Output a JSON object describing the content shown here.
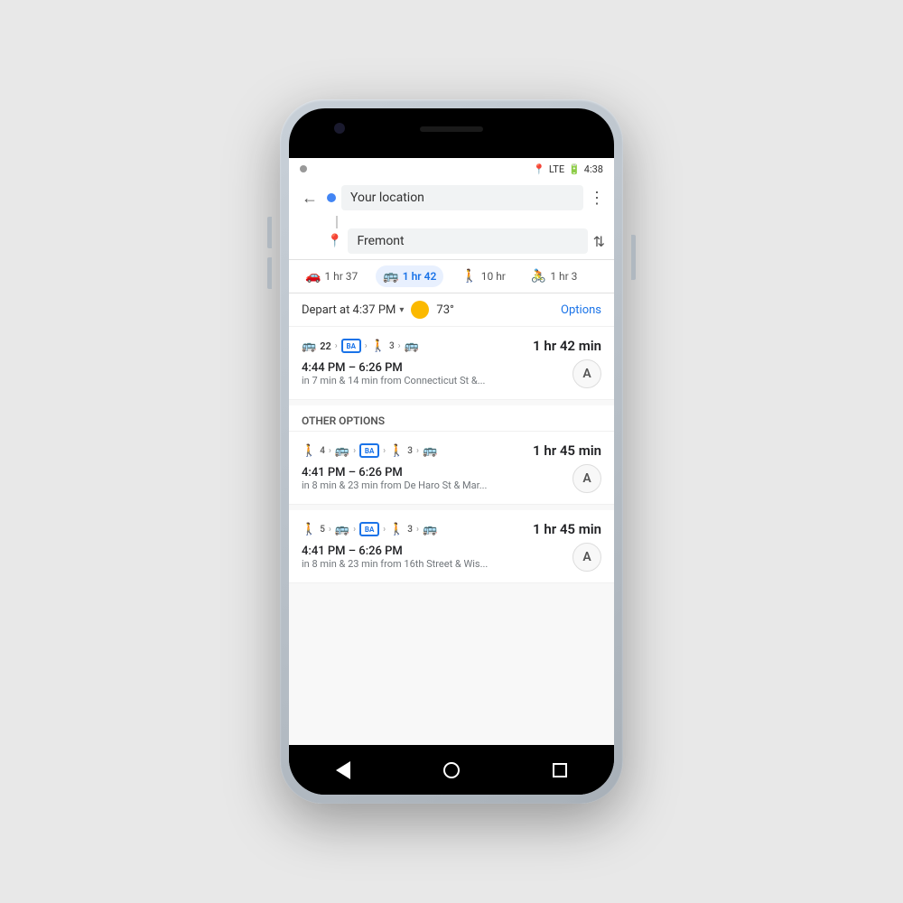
{
  "status": {
    "time": "4:38",
    "lte": "LTE",
    "battery": "⚡"
  },
  "header": {
    "back_icon": "←",
    "origin_label": "Your location",
    "destination_label": "Fremont",
    "more_icon": "⋮",
    "swap_icon": "⇅"
  },
  "tabs": [
    {
      "icon": "🚗",
      "label": "1 hr 37",
      "active": false
    },
    {
      "icon": "🚌",
      "label": "1 hr 42",
      "active": true
    },
    {
      "icon": "🚶",
      "label": "10 hr",
      "active": false
    },
    {
      "icon": "🚲",
      "label": "1 hr 3",
      "active": false
    }
  ],
  "depart": {
    "text": "Depart at 4:37 PM",
    "temp": "73°",
    "options_label": "Options"
  },
  "routes": [
    {
      "icons_text": "22  ›  BART  ›  🚶3  ›  🚌",
      "duration": "1 hr 42 min",
      "time_main": "4:44 PM – 6:26 PM",
      "time_sub": "in 7 min & 14 min from Connecticut St &...",
      "avatar": "A"
    }
  ],
  "other_options_label": "OTHER OPTIONS",
  "other_routes": [
    {
      "icons_text": "🚶4  ›  🚌  ›  BART  ›  🚶3  ›  🚌",
      "duration": "1 hr 45 min",
      "time_main": "4:41 PM – 6:26 PM",
      "time_sub": "in 8 min & 23 min from De Haro St & Mar...",
      "avatar": "A"
    },
    {
      "icons_text": "🚶5  ›  🚌  ›  BART  ›  🚶3  ›  🚌",
      "duration": "1 hr 45 min",
      "time_main": "4:41 PM – 6:26 PM",
      "time_sub": "in 8 min & 23 min from 16th Street & Wis...",
      "avatar": "A"
    }
  ]
}
